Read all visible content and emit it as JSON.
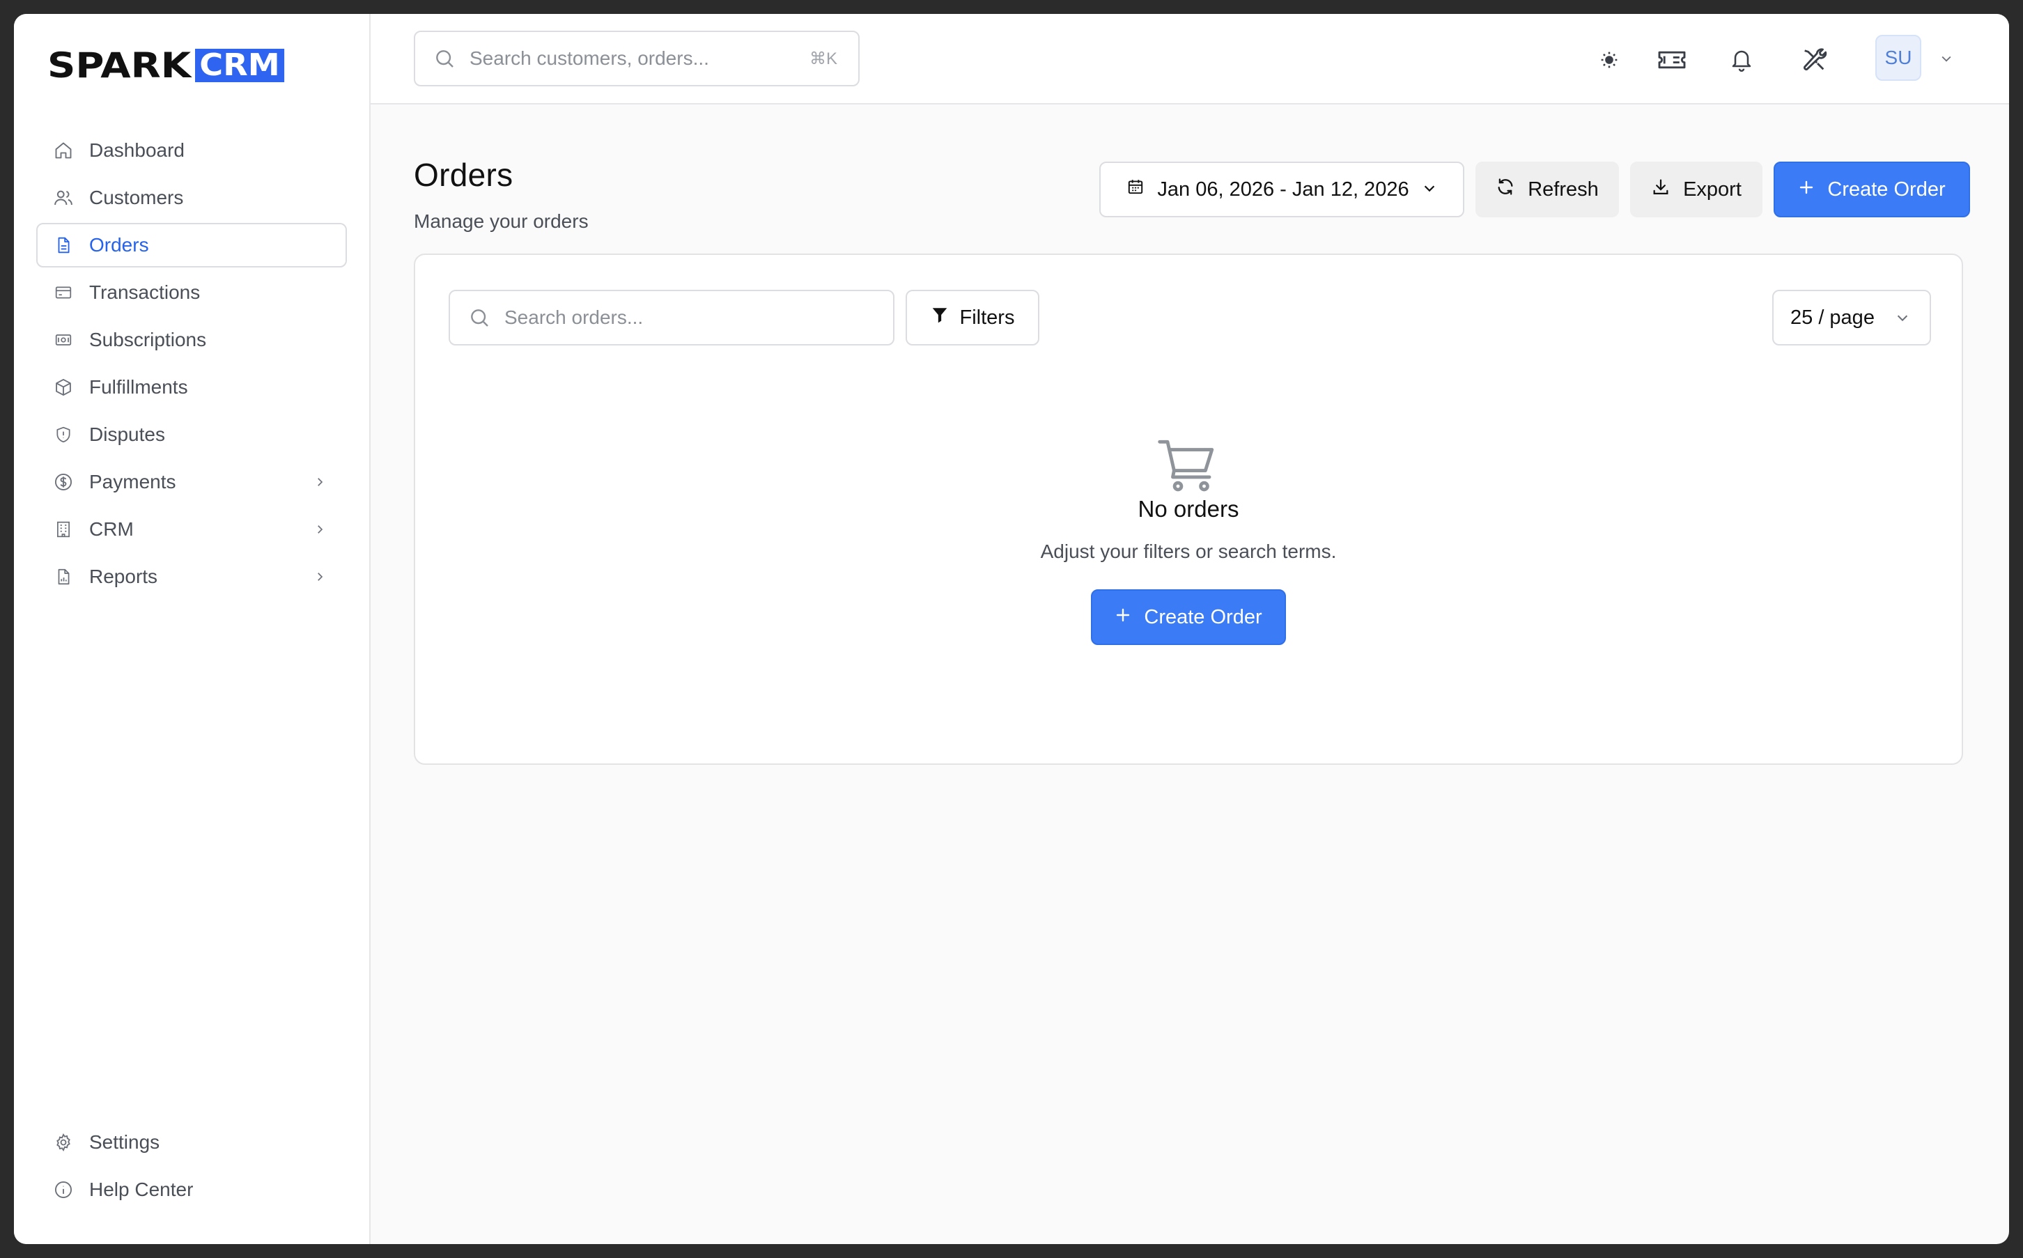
{
  "brand": {
    "part1": "SPARK",
    "part2": "CRM"
  },
  "sidebar": {
    "items": [
      {
        "label": "Dashboard",
        "icon": "home-icon"
      },
      {
        "label": "Customers",
        "icon": "users-icon"
      },
      {
        "label": "Orders",
        "icon": "document-icon",
        "active": true
      },
      {
        "label": "Transactions",
        "icon": "credit-card-icon"
      },
      {
        "label": "Subscriptions",
        "icon": "banknote-icon"
      },
      {
        "label": "Fulfillments",
        "icon": "package-icon"
      },
      {
        "label": "Disputes",
        "icon": "shield-icon"
      },
      {
        "label": "Payments",
        "icon": "dollar-circle-icon",
        "expandable": true
      },
      {
        "label": "CRM",
        "icon": "building-icon",
        "expandable": true
      },
      {
        "label": "Reports",
        "icon": "report-icon",
        "expandable": true
      }
    ],
    "bottom": [
      {
        "label": "Settings",
        "icon": "gear-icon"
      },
      {
        "label": "Help Center",
        "icon": "info-icon"
      }
    ]
  },
  "topbar": {
    "search_placeholder": "Search customers, orders...",
    "search_shortcut": "⌘K",
    "avatar_initials": "SU"
  },
  "page": {
    "title": "Orders",
    "subtitle": "Manage your orders"
  },
  "actions": {
    "date_range": "Jan 06, 2026 - Jan 12, 2026",
    "refresh": "Refresh",
    "export": "Export",
    "create": "Create Order"
  },
  "card": {
    "search_placeholder": "Search orders...",
    "filters": "Filters",
    "per_page": "25 / page",
    "empty_title": "No orders",
    "empty_subtitle": "Adjust your filters or search terms.",
    "empty_button": "Create Order"
  },
  "colors": {
    "accent": "#3b7cf6",
    "active_nav": "#2563eb",
    "brand_box": "#2e64f0"
  }
}
